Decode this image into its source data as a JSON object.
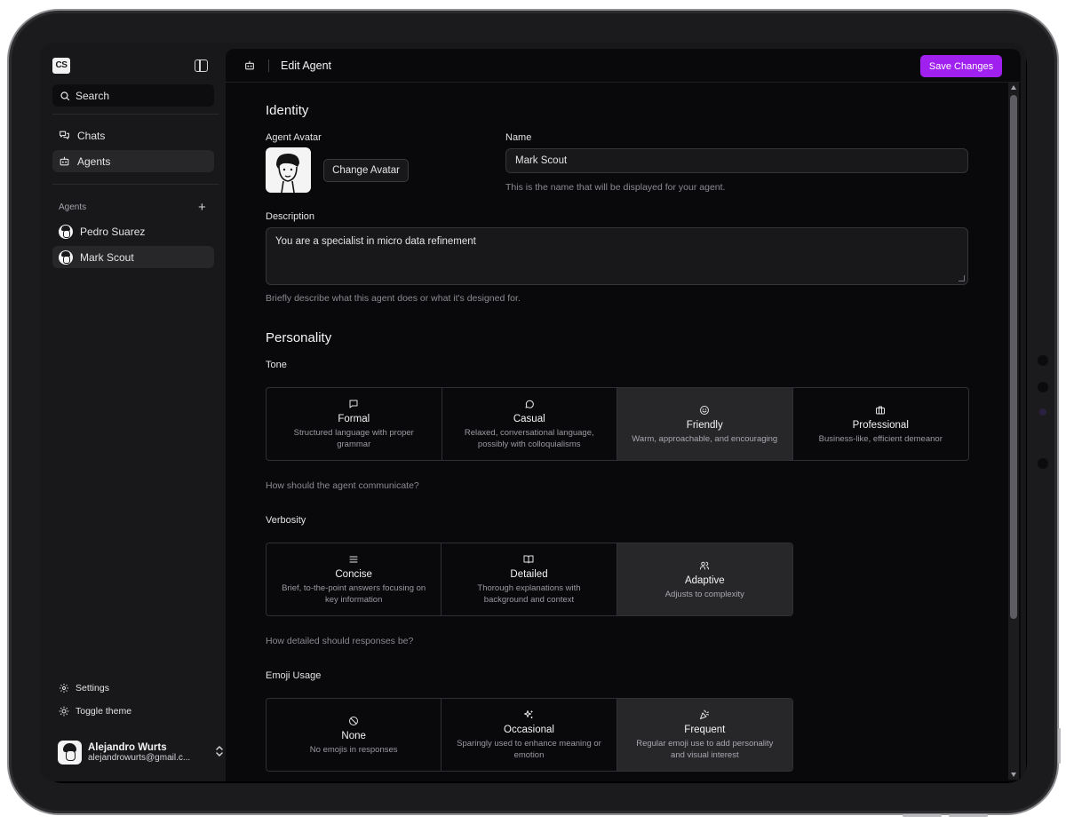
{
  "sidebar": {
    "logo": "CS",
    "search_label": "Search",
    "nav": [
      {
        "label": "Chats",
        "icon": "chat-bubbles-icon"
      },
      {
        "label": "Agents",
        "icon": "bot-icon"
      }
    ],
    "agents_section_label": "Agents",
    "agents": [
      {
        "label": "Pedro Suarez"
      },
      {
        "label": "Mark Scout"
      }
    ],
    "settings_label": "Settings",
    "toggle_theme_label": "Toggle theme",
    "user": {
      "name": "Alejandro Wurts",
      "email": "alejandrowurts@gmail.c..."
    }
  },
  "header": {
    "title": "Edit Agent",
    "save_label": "Save Changes"
  },
  "identity": {
    "heading": "Identity",
    "avatar_label": "Agent Avatar",
    "change_avatar_label": "Change Avatar",
    "name_label": "Name",
    "name_value": "Mark Scout",
    "name_hint": "This is the name that will be displayed for your agent.",
    "description_label": "Description",
    "description_value": "You are a specialist in micro data refinement",
    "description_hint": "Briefly describe what this agent does or what it's designed for."
  },
  "personality": {
    "heading": "Personality",
    "tone": {
      "label": "Tone",
      "hint": "How should the agent communicate?",
      "selected": "Friendly",
      "options": [
        {
          "title": "Formal",
          "desc": "Structured language with proper grammar",
          "icon": "message-square-icon"
        },
        {
          "title": "Casual",
          "desc": "Relaxed, conversational language, possibly with colloquialisms",
          "icon": "message-circle-icon"
        },
        {
          "title": "Friendly",
          "desc": "Warm, approachable, and encouraging",
          "icon": "smile-icon"
        },
        {
          "title": "Professional",
          "desc": "Business-like, efficient demeanor",
          "icon": "briefcase-icon"
        }
      ]
    },
    "verbosity": {
      "label": "Verbosity",
      "hint": "How detailed should responses be?",
      "selected": "Adaptive",
      "options": [
        {
          "title": "Concise",
          "desc": "Brief, to-the-point answers focusing on key information",
          "icon": "menu-lines-icon"
        },
        {
          "title": "Detailed",
          "desc": "Thorough explanations with background and context",
          "icon": "book-open-icon"
        },
        {
          "title": "Adaptive",
          "desc": "Adjusts to complexity",
          "icon": "users-icon"
        }
      ]
    },
    "emoji": {
      "label": "Emoji Usage",
      "selected": "Frequent",
      "options": [
        {
          "title": "None",
          "desc": "No emojis in responses",
          "icon": "ban-icon"
        },
        {
          "title": "Occasional",
          "desc": "Sparingly used to enhance meaning or emotion",
          "icon": "sparkles-icon"
        },
        {
          "title": "Frequent",
          "desc": "Regular emoji use to add personality and visual interest",
          "icon": "party-popper-icon"
        }
      ]
    }
  },
  "colors": {
    "accent": "#a020f0",
    "sidebar_bg": "#18181b",
    "main_bg": "#09090b",
    "selected_option_bg": "#27272a"
  }
}
